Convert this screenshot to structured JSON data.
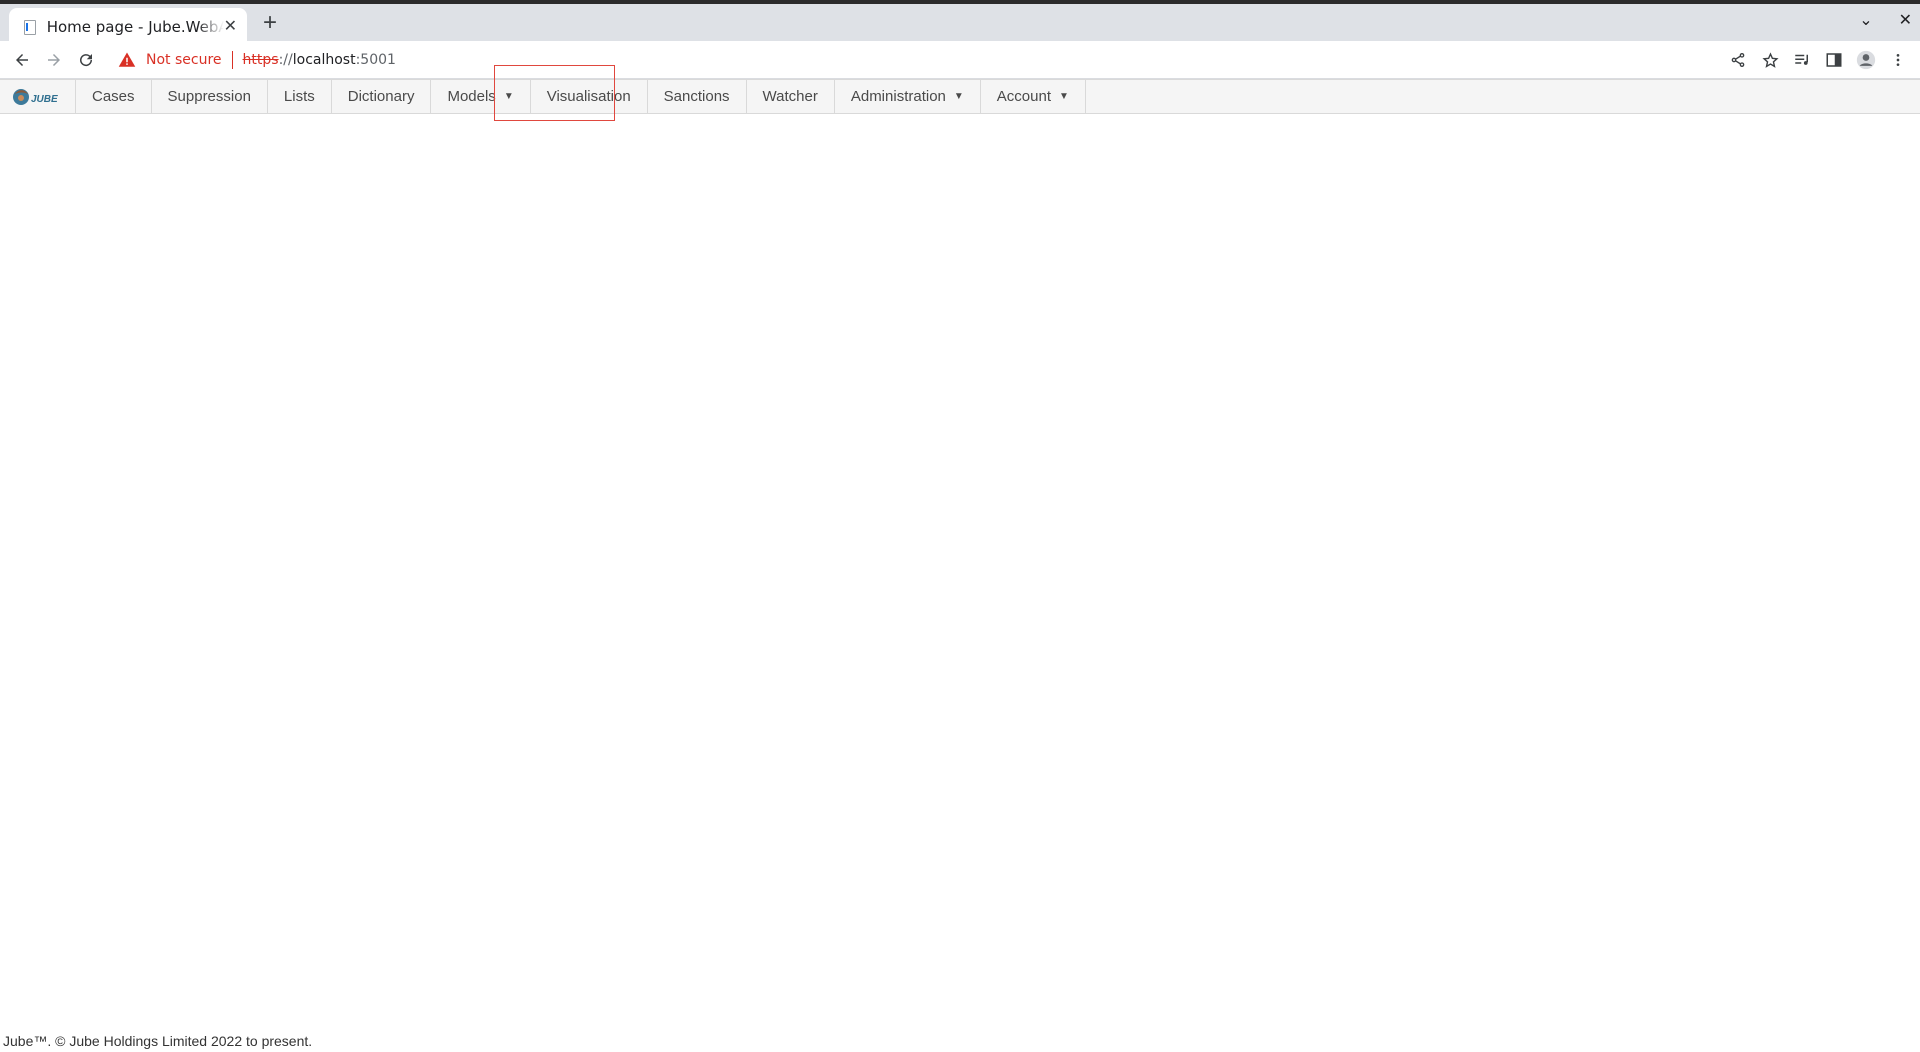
{
  "browser": {
    "tab_title": "Home page - Jube.WebApp",
    "tab_close": "✕",
    "new_tab": "+",
    "window_controls": {
      "menu": "⌄",
      "close": "✕"
    },
    "security_label": "Not secure",
    "url_scheme": "https",
    "url_sep": "://",
    "url_host": "localhost",
    "url_port": ":5001"
  },
  "app": {
    "brand": "JUBE",
    "nav_items": [
      {
        "label": "Cases",
        "dropdown": false
      },
      {
        "label": "Suppression",
        "dropdown": false
      },
      {
        "label": "Lists",
        "dropdown": false
      },
      {
        "label": "Dictionary",
        "dropdown": false
      },
      {
        "label": "Models",
        "dropdown": true
      },
      {
        "label": "Visualisation",
        "dropdown": false
      },
      {
        "label": "Sanctions",
        "dropdown": false
      },
      {
        "label": "Watcher",
        "dropdown": false
      },
      {
        "label": "Administration",
        "dropdown": true
      },
      {
        "label": "Account",
        "dropdown": true
      }
    ],
    "caret": "▼",
    "highlighted_item": "Visualisation"
  },
  "footer": {
    "text": "Jube™. © Jube Holdings Limited 2022 to present."
  },
  "colors": {
    "warning": "#d93025",
    "highlight": "#e0473e",
    "nav_bg": "#f5f5f5"
  }
}
